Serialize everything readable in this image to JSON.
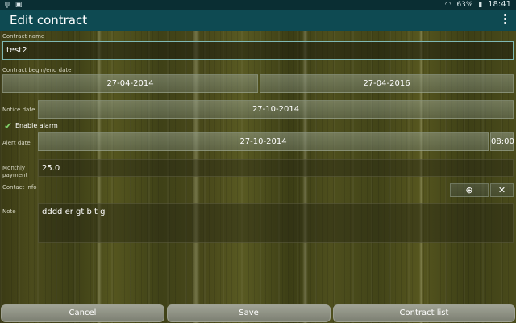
{
  "status_bar": {
    "left_icons": [
      "usb-icon",
      "image-icon"
    ],
    "battery": "63%",
    "time": "18:41"
  },
  "action_bar": {
    "title": "Edit contract",
    "overflow_icon": "more-vertical-icon"
  },
  "form": {
    "contract_name": {
      "label": "Contract name",
      "value": "test2"
    },
    "dates": {
      "label": "Contract begin/end date",
      "begin": "27-04-2014",
      "end": "27-04-2016"
    },
    "notice": {
      "label": "Notice date",
      "value": "27-10-2014"
    },
    "alarm": {
      "label": "Enable alarm",
      "checked": true
    },
    "alert": {
      "label": "Alert date",
      "date": "27-10-2014",
      "time": "08:00"
    },
    "payment": {
      "label_line1": "Monthly",
      "label_line2": "payment",
      "value": "25.0"
    },
    "contact": {
      "label": "Contact info",
      "add_icon": "add-circle-icon",
      "clear_icon": "close-icon"
    },
    "note": {
      "label": "Note",
      "value": "dddd er gt b t g"
    }
  },
  "buttons": {
    "cancel": "Cancel",
    "save": "Save",
    "contract_list": "Contract list"
  }
}
